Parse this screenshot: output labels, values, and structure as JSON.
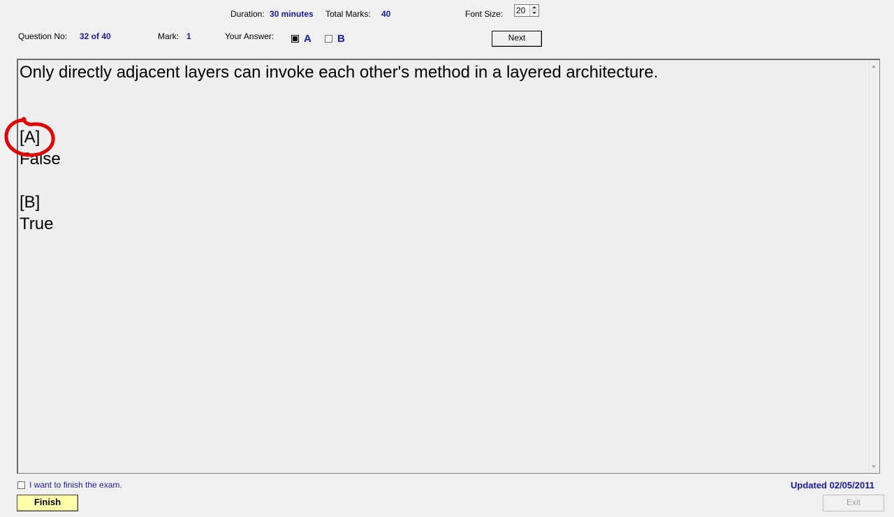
{
  "header": {
    "duration_label": "Duration:",
    "duration_value": "30 minutes",
    "total_marks_label": "Total Marks:",
    "total_marks_value": "40",
    "font_size_label": "Font Size:",
    "font_size_value": "20",
    "question_no_label": "Question No:",
    "question_no_value": "32 of 40",
    "mark_label": "Mark:",
    "mark_value": "1",
    "your_answer_label": "Your Answer:",
    "answer_options": [
      {
        "letter": "A",
        "checked": true
      },
      {
        "letter": "B",
        "checked": false
      }
    ],
    "next_label": "Next"
  },
  "question": {
    "text": "Only directly adjacent layers can invoke each other's method in a layered architecture.",
    "options": [
      {
        "tag": "[A]",
        "text": "False"
      },
      {
        "tag": "[B]",
        "text": "True"
      }
    ]
  },
  "footer": {
    "finish_checkbox_label": "I want to finish the exam.",
    "finish_checkbox_checked": false,
    "finish_label": "Finish",
    "updated_text": "Updated 02/05/2011",
    "exit_label": "Exit"
  },
  "annotation": {
    "color": "#e00000",
    "description_icon": "red-circle-annotation"
  },
  "colors": {
    "value_blue": "#1a1aa6",
    "finish_yellow": "#ffffa8",
    "background": "#f0f0f0"
  }
}
